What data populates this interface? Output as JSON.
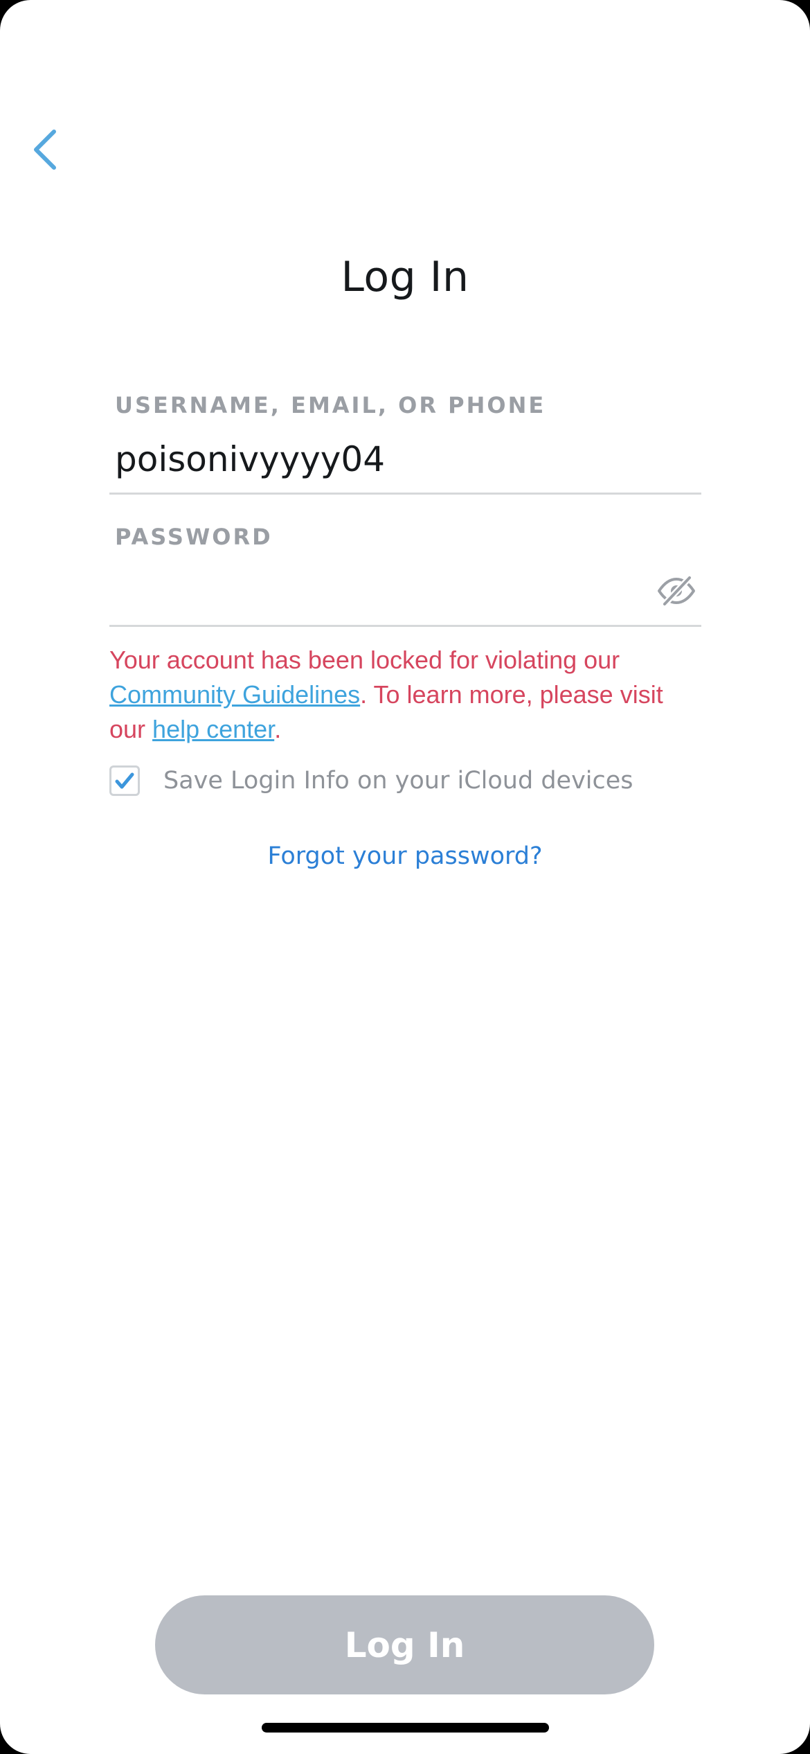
{
  "colors": {
    "back_accent": "#56a8de",
    "error_text": "#d6455e",
    "link_blue": "#3ea3dd",
    "forgot_link": "#2b7fd6",
    "checkbox_check": "#3c96dc",
    "button_disabled_bg": "#b9bdc4"
  },
  "header": {
    "back_icon": "chevron-left-icon"
  },
  "page": {
    "title": "Log In"
  },
  "form": {
    "username": {
      "label": "USERNAME, EMAIL, OR PHONE",
      "value": "poisonivyyyy04"
    },
    "password": {
      "label": "PASSWORD",
      "value": "",
      "toggle_icon": "eye-slash-icon"
    },
    "error": {
      "text_1": "Your account has been locked for violating our",
      "link_1": "Community Guidelines",
      "text_2": ". To learn more, please visit our",
      "link_2": "help center",
      "text_3": "."
    },
    "save_login": {
      "checked": true,
      "label": "Save Login Info on your iCloud devices",
      "check_icon": "checkmark-icon"
    },
    "forgot_password": "Forgot your password?"
  },
  "footer": {
    "login_button": "Log In"
  }
}
